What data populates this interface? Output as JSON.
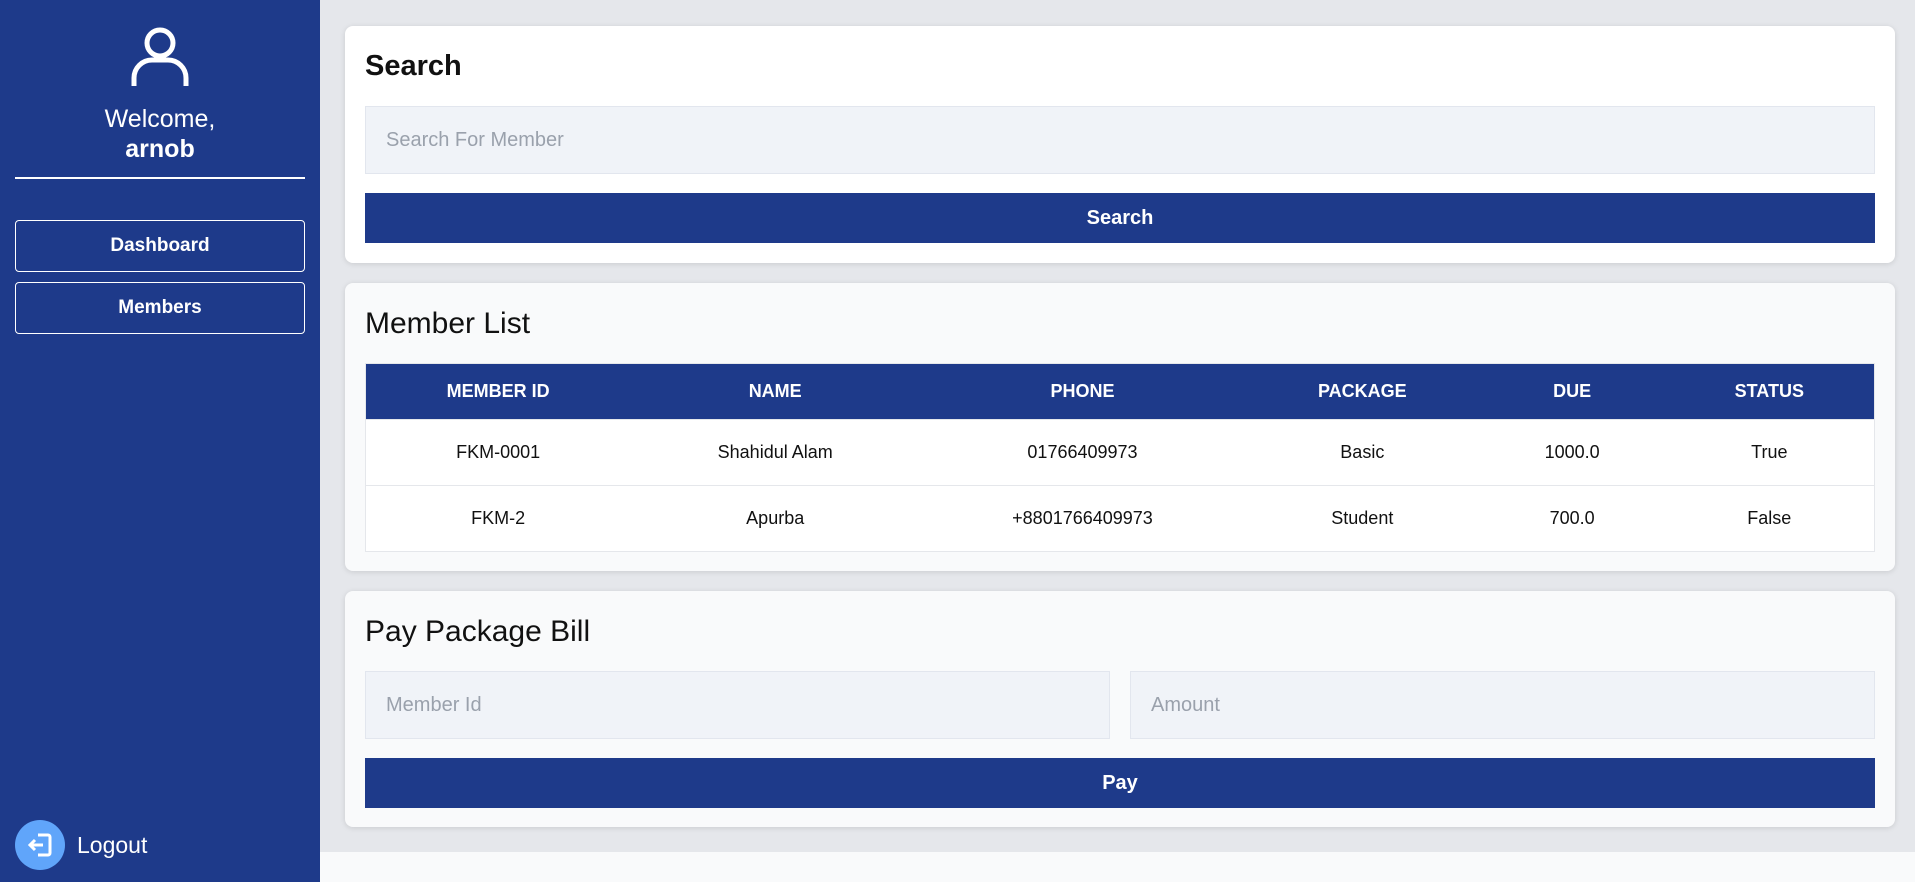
{
  "sidebar": {
    "welcome": "Welcome,",
    "username": "arnob",
    "nav": [
      {
        "label": "Dashboard"
      },
      {
        "label": "Members"
      }
    ],
    "logout_label": "Logout",
    "avatar_icon": "user-icon",
    "logout_icon": "logout-icon"
  },
  "search_card": {
    "title": "Search",
    "input_placeholder": "Search For Member",
    "button_label": "Search"
  },
  "member_list": {
    "title": "Member List",
    "columns": [
      "MEMBER ID",
      "NAME",
      "PHONE",
      "PACKAGE",
      "DUE",
      "STATUS"
    ],
    "rows": [
      [
        "FKM-0001",
        "Shahidul Alam",
        "01766409973",
        "Basic",
        "1000.0",
        "True"
      ],
      [
        "FKM-2",
        "Apurba",
        "+8801766409973",
        "Student",
        "700.0",
        "False"
      ]
    ]
  },
  "pay_card": {
    "title": "Pay Package Bill",
    "member_id_placeholder": "Member Id",
    "amount_placeholder": "Amount",
    "button_label": "Pay"
  },
  "colors": {
    "primary": "#1e3a8a",
    "logout_accent": "#60a5fa",
    "page_bg": "#e5e7eb"
  }
}
